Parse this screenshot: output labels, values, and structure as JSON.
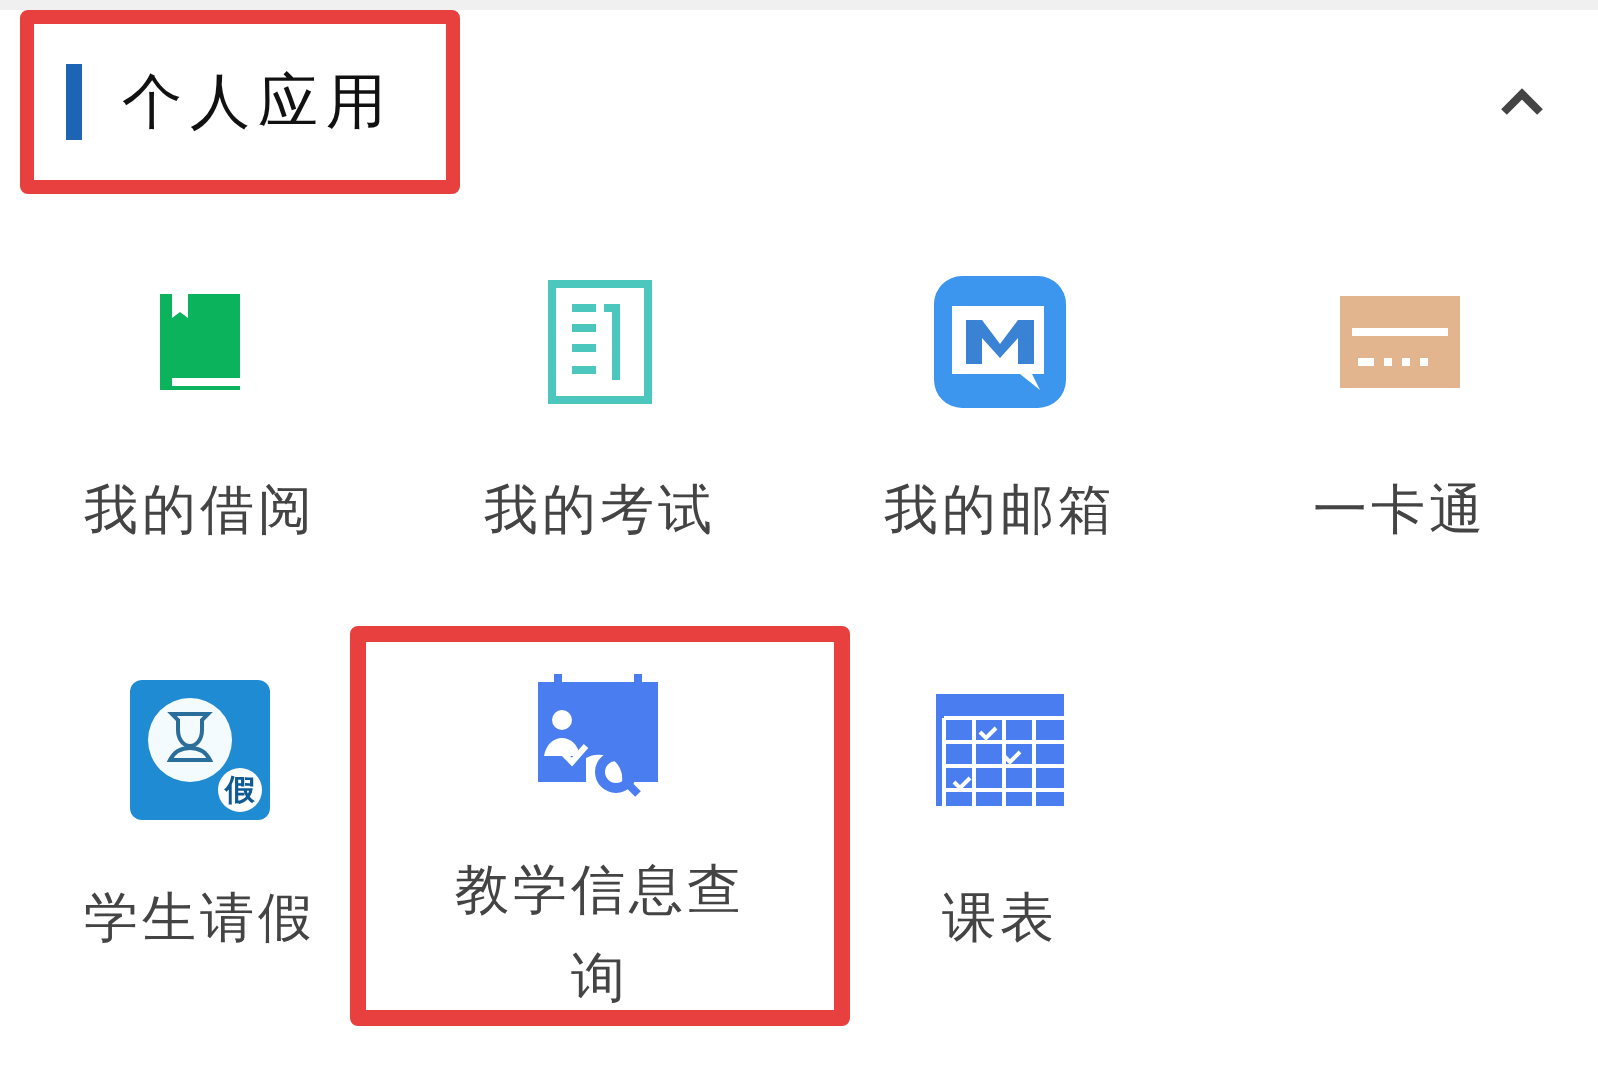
{
  "section": {
    "title": "个人应用",
    "highlighted": true,
    "expanded": true
  },
  "apps": [
    {
      "kind": "book",
      "label": "我的借阅",
      "highlighted": false
    },
    {
      "kind": "exam",
      "label": "我的考试",
      "highlighted": false
    },
    {
      "kind": "mail",
      "label": "我的邮箱",
      "highlighted": false
    },
    {
      "kind": "card",
      "label": "一卡通",
      "highlighted": false
    },
    {
      "kind": "leave",
      "label": "学生请假",
      "icon_text": "假",
      "highlighted": false
    },
    {
      "kind": "query",
      "label": "教学信息查询",
      "highlighted": true
    },
    {
      "kind": "timetable",
      "label": "课表",
      "highlighted": false
    }
  ]
}
